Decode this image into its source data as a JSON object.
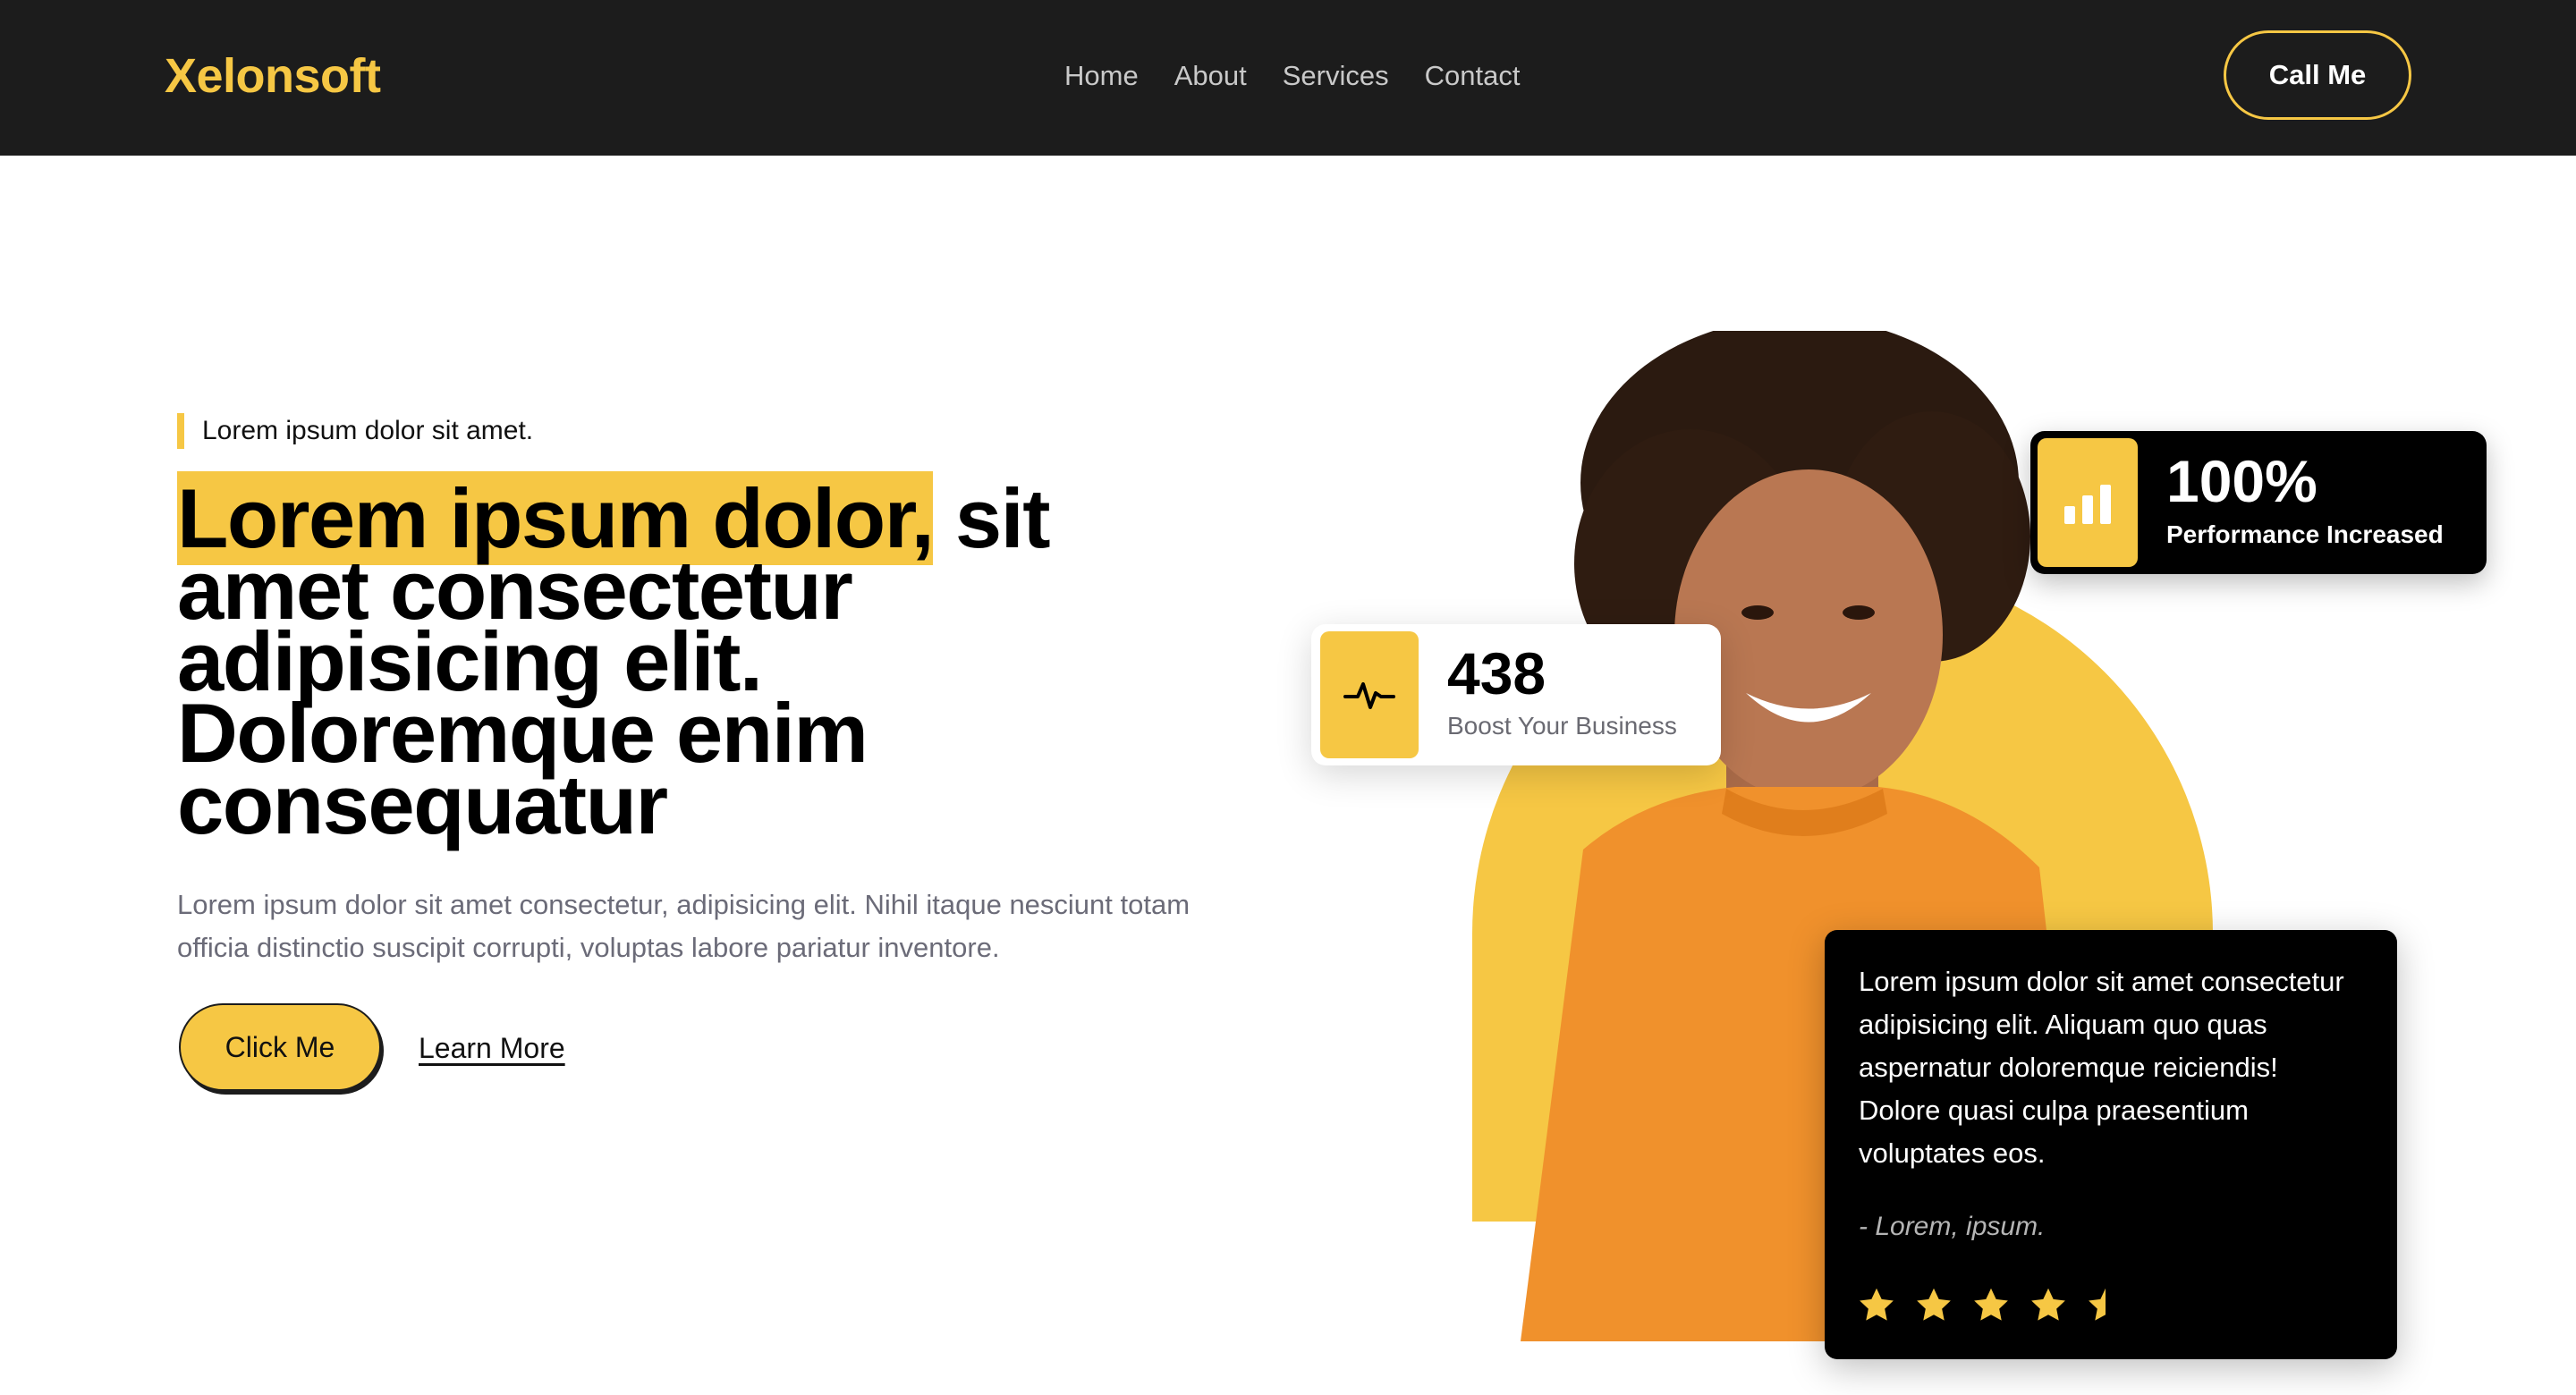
{
  "navbar": {
    "logo": "Xelonsoft",
    "links": [
      "Home",
      "About",
      "Services",
      "Contact"
    ],
    "cta_label": "Call Me"
  },
  "hero": {
    "eyebrow": "Lorem ipsum dolor sit amet.",
    "headline_highlight": "Lorem ipsum dolor,",
    "headline_rest": " sit amet consectetur adipisicing elit. Doloremque enim consequatur",
    "subtext": "Lorem ipsum dolor sit amet consectetur, adipisicing elit. Nihil itaque nesciunt totam officia distinctio suscipit corrupti, voluptas labore pariatur inventore.",
    "primary_button": "Click Me",
    "secondary_link": "Learn More"
  },
  "stat_card": {
    "icon": "pulse-icon",
    "value": "438",
    "label": "Boost Your Business"
  },
  "performance_card": {
    "icon": "bar-chart-icon",
    "value": "100%",
    "label": "Performance Increased"
  },
  "testimonial": {
    "quote": "Lorem ipsum dolor sit amet consectetur adipisicing elit. Aliquam quo quas aspernatur doloremque reiciendis! Dolore quasi culpa praesentium voluptates eos.",
    "author": "- Lorem, ipsum.",
    "rating": 4.5,
    "rating_max": 5
  },
  "colors": {
    "accent": "#f6c744",
    "nav_bg": "#1c1c1c",
    "card_dark": "#000000"
  }
}
